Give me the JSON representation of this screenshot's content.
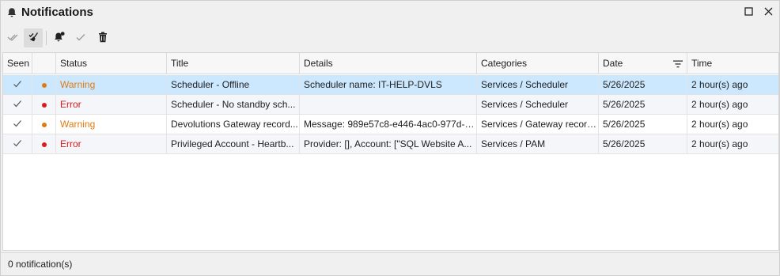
{
  "window": {
    "title": "Notifications",
    "title_icon": "bell-icon",
    "maximize_icon": "maximize-icon",
    "close_icon": "close-icon"
  },
  "toolbar": {
    "buttons": [
      {
        "name": "mark-all-seen-button",
        "icon": "double-check-icon"
      },
      {
        "name": "mark-seen-cleanup-button",
        "icon": "broom-check-icon",
        "active": true
      },
      {
        "name": "notification-settings-button",
        "icon": "bell-settings-icon"
      },
      {
        "name": "mark-seen-button",
        "icon": "check-icon"
      },
      {
        "name": "delete-button",
        "icon": "trash-icon"
      }
    ]
  },
  "grid": {
    "columns": [
      {
        "key": "seen",
        "label": "Seen"
      },
      {
        "key": "dot",
        "label": ""
      },
      {
        "key": "status",
        "label": "Status"
      },
      {
        "key": "title",
        "label": "Title"
      },
      {
        "key": "details",
        "label": "Details"
      },
      {
        "key": "categories",
        "label": "Categories"
      },
      {
        "key": "date",
        "label": "Date",
        "filter_icon": "filter-icon"
      },
      {
        "key": "time",
        "label": "Time"
      }
    ],
    "rows": [
      {
        "seen": true,
        "status": "Warning",
        "status_color": "#e07b10",
        "title": "Scheduler - Offline",
        "details": "Scheduler name: IT-HELP-DVLS",
        "categories": "Services / Scheduler",
        "date": "5/26/2025",
        "time": "2 hour(s) ago",
        "selected": true
      },
      {
        "seen": true,
        "status": "Error",
        "status_color": "#e01a1a",
        "title": "Scheduler - No standby sch...",
        "details": "",
        "categories": "Services / Scheduler",
        "date": "5/26/2025",
        "time": "2 hour(s) ago",
        "selected": false
      },
      {
        "seen": true,
        "status": "Warning",
        "status_color": "#e07b10",
        "title": "Devolutions Gateway record...",
        "details": "Message: 989e57c8-e446-4ac0-977d-bc...",
        "categories": "Services / Gateway record...",
        "date": "5/26/2025",
        "time": "2 hour(s) ago",
        "selected": false
      },
      {
        "seen": true,
        "status": "Error",
        "status_color": "#e01a1a",
        "title": "Privileged Account - Heartb...",
        "details": "Provider: [], Account: [\"SQL Website A...",
        "categories": "Services / PAM",
        "date": "5/26/2025",
        "time": "2 hour(s) ago",
        "selected": false
      }
    ]
  },
  "statusbar": {
    "text": "0 notification(s)"
  },
  "colors": {
    "selected_row": "#cce8ff",
    "warning": "#e07b10",
    "error": "#e01a1a"
  }
}
